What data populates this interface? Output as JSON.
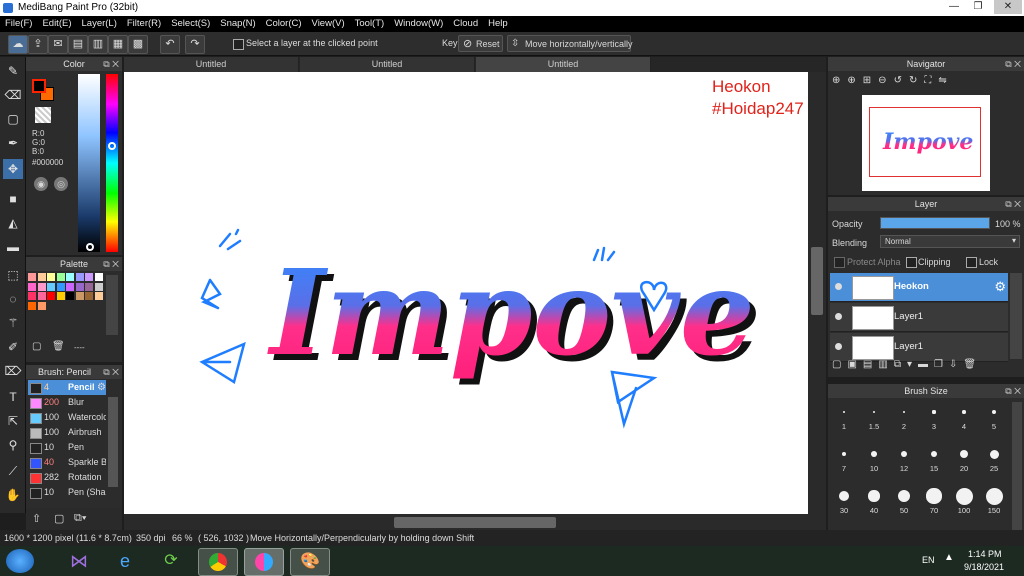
{
  "window": {
    "title": "MediBang Paint Pro (32bit)"
  },
  "menu": [
    "File(F)",
    "Edit(E)",
    "Layer(L)",
    "Filter(R)",
    "Select(S)",
    "Snap(N)",
    "Color(C)",
    "View(V)",
    "Tool(T)",
    "Window(W)",
    "Cloud",
    "Help"
  ],
  "toolbar": {
    "select_layer_label": "Select a layer at the clicked point",
    "key_label": "Key",
    "reset_label": "Reset",
    "move_mode_label": "Move horizontally/vertically"
  },
  "color_panel": {
    "title": "Color",
    "r": "R:0",
    "g": "G:0",
    "b": "B:0",
    "hex": "#000000",
    "primary_color": "#000000",
    "secondary_color": "#ff6a00"
  },
  "palette_panel": {
    "title": "Palette",
    "swatches": [
      "#ff9999",
      "#ffcc99",
      "#ffff99",
      "#99ff99",
      "#99ffff",
      "#9999ff",
      "#cc99ff",
      "#ffffff",
      "#ff66cc",
      "#ff99cc",
      "#66ccff",
      "#3399ff",
      "#cc66ff",
      "#9966cc",
      "#996699",
      "#cccccc",
      "#ff3366",
      "#ff6699",
      "#ff0000",
      "#ffcc00",
      "#000000",
      "#cc9966",
      "#996633",
      "#ffcc99",
      "#ff6600",
      "#ff9966"
    ],
    "menu_glyph": "----"
  },
  "brush_panel": {
    "title": "Brush: Pencil",
    "items": [
      {
        "size": "4",
        "name": "Pencil",
        "color": "#222222"
      },
      {
        "size": "200",
        "name": "Blur",
        "color": "#ff88ff"
      },
      {
        "size": "100",
        "name": "Watercolor",
        "color": "#66ccff"
      },
      {
        "size": "100",
        "name": "Airbrush",
        "color": "#bbbbbb"
      },
      {
        "size": "10",
        "name": "Pen",
        "color": "#222222"
      },
      {
        "size": "40",
        "name": "Sparkle Brush",
        "color": "#3355ff"
      },
      {
        "size": "282",
        "name": "Rotation",
        "color": "#ff3333"
      },
      {
        "size": "10",
        "name": "Pen (Sha",
        "color": "#222222"
      }
    ]
  },
  "tabs": [
    "Untitled",
    "Untitled",
    "Untitled"
  ],
  "canvas": {
    "artwork_text": "Impove",
    "watermark_line1": "Heokon",
    "watermark_line2": "#Hoidap247"
  },
  "navigator": {
    "title": "Navigator"
  },
  "layer_panel": {
    "title": "Layer",
    "opacity_label": "Opacity",
    "opacity_value": "100 %",
    "opacity_fraction": 1.0,
    "blending_label": "Blending",
    "blending_value": "Normal",
    "protect_alpha_label": "Protect Alpha",
    "clipping_label": "Clipping",
    "lock_label": "Lock",
    "layers": [
      {
        "name": "Heokon",
        "selected": true
      },
      {
        "name": "Layer1",
        "selected": false
      },
      {
        "name": "Layer1",
        "selected": false
      }
    ]
  },
  "brush_size_panel": {
    "title": "Brush Size",
    "sizes": [
      "1",
      "1.5",
      "2",
      "3",
      "4",
      "5",
      "7",
      "10",
      "12",
      "15",
      "20",
      "25",
      "30",
      "40",
      "50",
      "70",
      "100",
      "150"
    ]
  },
  "status": {
    "dimensions": "1600 * 1200 pixel",
    "physical": "(11.6 * 8.7cm)",
    "dpi": "350 dpi",
    "zoom": "66 %",
    "coords": "( 526, 1032 )",
    "hint": "Move Horizontally/Perpendicularly by holding down Shift"
  },
  "taskbar": {
    "lang": "EN",
    "time": "1:14 PM",
    "date": "9/18/2021"
  }
}
